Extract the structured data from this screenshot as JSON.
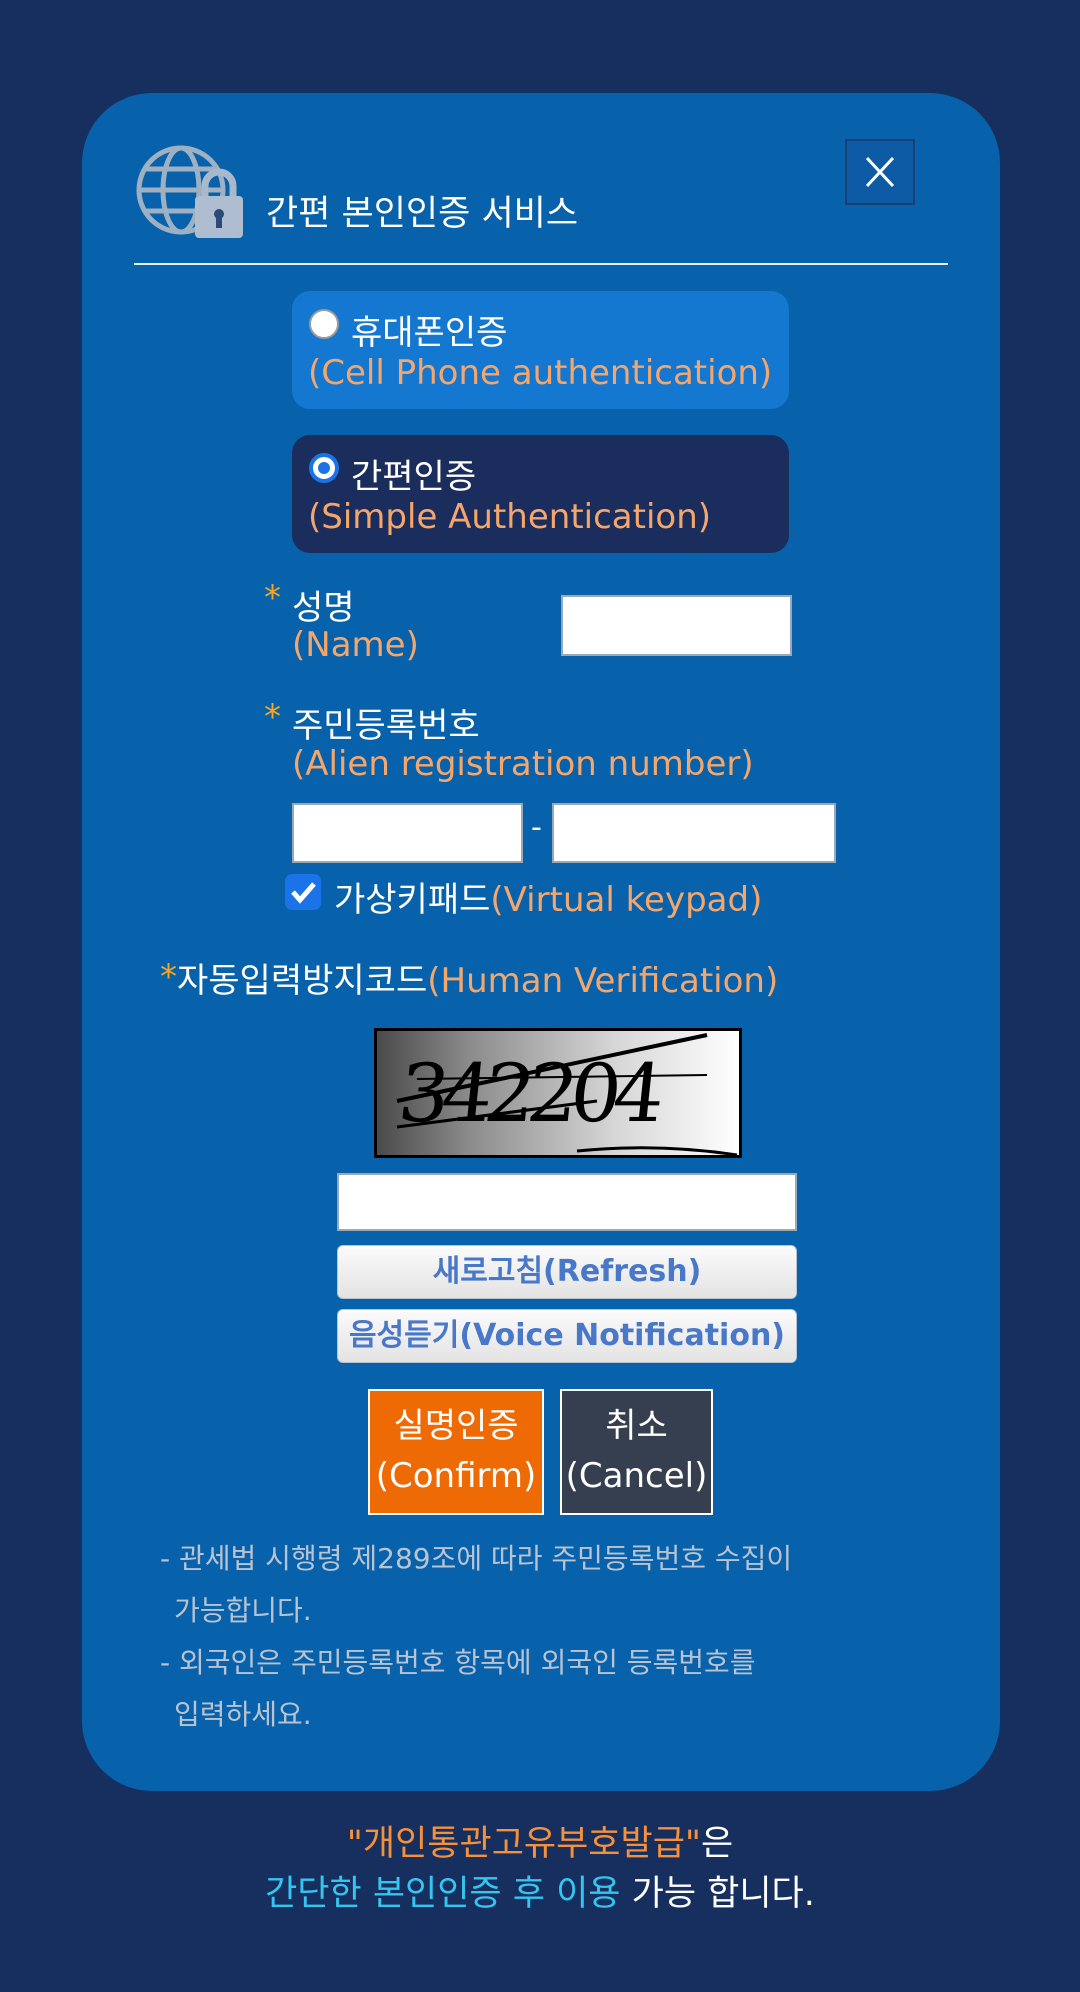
{
  "header": {
    "title": "간편 본인인증 서비스",
    "icon": "globe-lock-icon",
    "close_label": "X"
  },
  "auth_options": [
    {
      "label_ko": "휴대폰인증",
      "label_en": "(Cell Phone authentication)",
      "selected": false
    },
    {
      "label_ko": "간편인증",
      "label_en": "(Simple Authentication)",
      "selected": true
    }
  ],
  "form": {
    "required_mark": "*",
    "name_label_ko": "성명",
    "name_label_en": "(Name)",
    "name_value": "",
    "rrn_label_ko": "주민등록번호",
    "rrn_label_en": "(Alien registration number)",
    "rrn_first_value": "",
    "rrn_separator": "-",
    "rrn_second_value": "",
    "keypad_label_ko": "가상키패드",
    "keypad_label_en": "(Virtual keypad)",
    "keypad_checked": true
  },
  "captcha": {
    "label_ko": "자동입력방지코드",
    "label_en": "(Human Verification)",
    "code": "342204",
    "input_value": "",
    "refresh_label": "새로고침(Refresh)",
    "voice_label": "음성듣기(Voice Notification)"
  },
  "actions": {
    "confirm_ko": "실명인증",
    "confirm_en": "(Confirm)",
    "cancel_ko": "취소",
    "cancel_en": "(Cancel)"
  },
  "notes": [
    {
      "line1": "- 관세법 시행령 제289조에 따라 주민등록번호 수집이",
      "line2": "가능합니다."
    },
    {
      "line1": "- 외국인은 주민등록번호 항목에 외국인 등록번호를",
      "line2": "입력하세요."
    }
  ],
  "footer": {
    "service_name": "\"개인통관고유부호발급\"",
    "particle": "은",
    "highlight": "간단한 본인인증 후 이용",
    "suffix": " 가능 합니다."
  },
  "colors": {
    "background": "#172f5e",
    "modal": "#0762ab",
    "english_text": "#f5a66b",
    "confirm": "#ee6a05",
    "cancel": "#353f4f",
    "footer_orange": "#f5903b",
    "footer_cyan": "#34c6f0"
  }
}
